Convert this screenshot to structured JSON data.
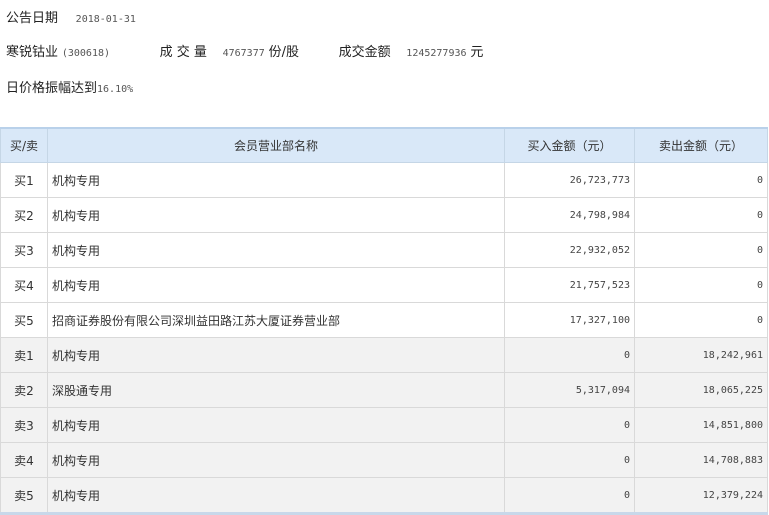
{
  "header": {
    "date_label": "公告日期",
    "date_value": "2018-01-31",
    "stock_name": "寒锐钴业",
    "stock_code": "(300618)",
    "volume_label": "成 交 量",
    "volume_value": "4767377",
    "volume_unit": "份/股",
    "amount_label": "成交金额",
    "amount_value": "1245277936",
    "amount_unit": "元",
    "reason_text": "日价格振幅达到",
    "reason_value": "16.10%"
  },
  "table": {
    "columns": [
      "买/卖",
      "会员营业部名称",
      "买入金额（元）",
      "卖出金额（元）"
    ],
    "rows": [
      {
        "type": "买1",
        "name": "机构专用",
        "buy": "26,723,773",
        "sell": "0"
      },
      {
        "type": "买2",
        "name": "机构专用",
        "buy": "24,798,984",
        "sell": "0"
      },
      {
        "type": "买3",
        "name": "机构专用",
        "buy": "22,932,052",
        "sell": "0"
      },
      {
        "type": "买4",
        "name": "机构专用",
        "buy": "21,757,523",
        "sell": "0"
      },
      {
        "type": "买5",
        "name": "招商证券股份有限公司深圳益田路江苏大厦证券营业部",
        "buy": "17,327,100",
        "sell": "0"
      },
      {
        "type": "卖1",
        "name": "机构专用",
        "buy": "0",
        "sell": "18,242,961"
      },
      {
        "type": "卖2",
        "name": "深股通专用",
        "buy": "5,317,094",
        "sell": "18,065,225"
      },
      {
        "type": "卖3",
        "name": "机构专用",
        "buy": "0",
        "sell": "14,851,800"
      },
      {
        "type": "卖4",
        "name": "机构专用",
        "buy": "0",
        "sell": "14,708,883"
      },
      {
        "type": "卖5",
        "name": "机构专用",
        "buy": "0",
        "sell": "12,379,224"
      }
    ]
  }
}
